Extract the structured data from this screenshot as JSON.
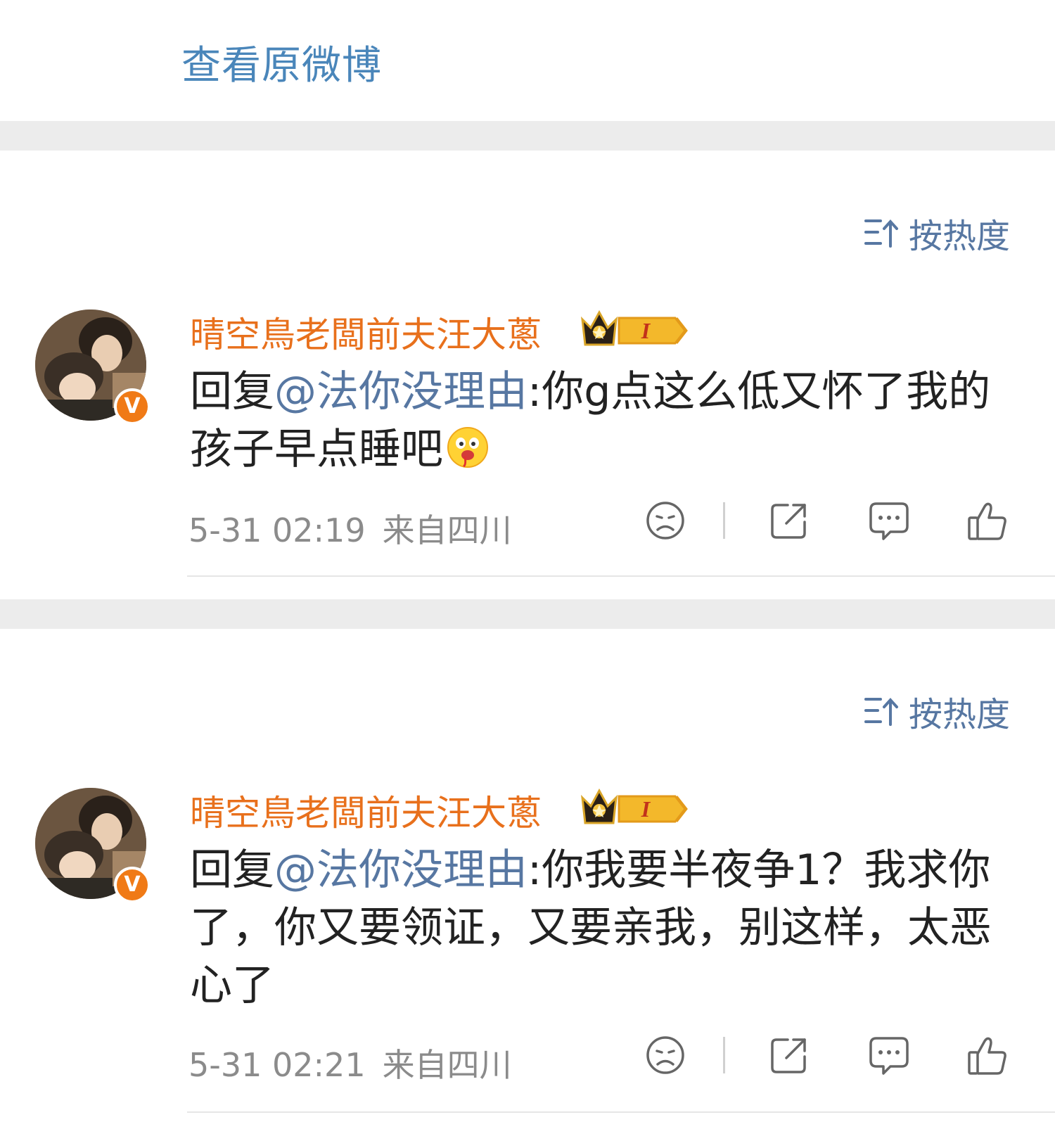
{
  "header": {
    "view_original": "查看原微博"
  },
  "sort": {
    "label": "按热度"
  },
  "comments": [
    {
      "username": "晴空鳥老闆前夫汪大蔥",
      "vip_level": "I",
      "reply_prefix": "回复",
      "mention": "@法你没理由",
      "body": ":你g点这么低又怀了我的孩子早点睡吧",
      "emoji": "drool-emoji",
      "time": "5-31 02:19",
      "location": "来自四川"
    },
    {
      "username": "晴空鳥老闆前夫汪大蔥",
      "vip_level": "I",
      "reply_prefix": "回复",
      "mention": "@法你没理由",
      "body": ":你我要半夜争1？我求你了，你又要领证，又要亲我，别这样，太恶心了",
      "time": "5-31 02:21",
      "location": "来自四川"
    }
  ],
  "icons": {
    "sort": "sort-icon",
    "dislike": "sad-face-icon",
    "share": "share-icon",
    "reply": "comment-bubble-icon",
    "like": "thumbs-up-icon",
    "verified": "verified-v-icon",
    "vip": "crown-badge-icon"
  },
  "colors": {
    "link": "#4a86ba",
    "username": "#e8701c",
    "mention": "#5777a2",
    "meta": "#8b8b8b",
    "band": "#ececec",
    "verified": "#f07a16"
  }
}
